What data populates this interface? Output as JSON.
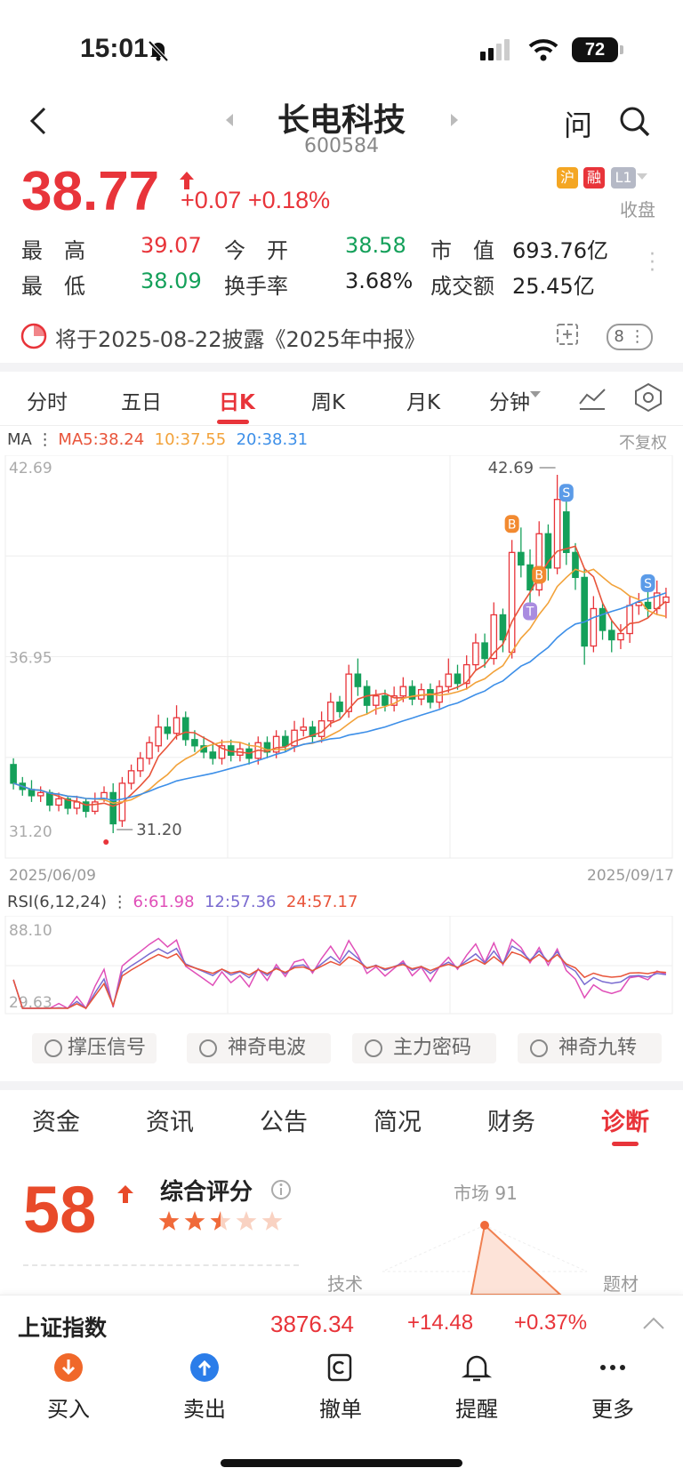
{
  "status_bar": {
    "time": "15:01",
    "battery": "72"
  },
  "header": {
    "title": "长电科技",
    "code": "600584",
    "ask": "问"
  },
  "quote": {
    "price": "38.77",
    "change": "+0.07",
    "change_pct": "+0.18%",
    "tags": [
      {
        "text": "沪",
        "color": "#f4a623"
      },
      {
        "text": "融",
        "color": "#e8343a"
      },
      {
        "text": "L1",
        "color": "#b5b9c6"
      }
    ],
    "status": "收盘",
    "rows": [
      [
        {
          "label": "最　高",
          "value": "39.07",
          "color": "red"
        },
        {
          "label": "今　开",
          "value": "38.58",
          "color": "green"
        },
        {
          "label": "市　值",
          "value": "693.76亿",
          "color": "plain"
        }
      ],
      [
        {
          "label": "最　低",
          "value": "38.09",
          "color": "green"
        },
        {
          "label": "换手率",
          "value": "3.68%",
          "color": "plain"
        },
        {
          "label": "成交额",
          "value": "25.45亿",
          "color": "plain"
        }
      ]
    ],
    "notice": "将于2025-08-22披露《2025年中报》",
    "notice_count": "8"
  },
  "chart_tabs": [
    "分时",
    "五日",
    "日K",
    "周K",
    "月K",
    "分钟"
  ],
  "chart_tab_active": 2,
  "ma": {
    "label": "MA",
    "ma5": "MA5:38.24",
    "ma10": "10:37.55",
    "ma20": "20:38.31",
    "adjust": "不复权"
  },
  "chart_data": {
    "type": "candlestick",
    "date_start": "2025/06/09",
    "date_end": "2025/09/17",
    "y_ticks": [
      "42.69",
      "36.95",
      "31.20"
    ],
    "ylim": [
      31.2,
      42.69
    ],
    "high_label": "42.69",
    "low_label": "31.20",
    "markers": [
      {
        "text": "B",
        "index": 55,
        "color": "#f28a30"
      },
      {
        "text": "B",
        "index": 58,
        "color": "#f28a30"
      },
      {
        "text": "T",
        "index": 57,
        "color": "#a98ce0"
      },
      {
        "text": "S",
        "index": 61,
        "color": "#5b9be8"
      },
      {
        "text": "S",
        "index": 70,
        "color": "#5b9be8"
      }
    ],
    "candles": [
      [
        33.4,
        32.8,
        33.6,
        32.6
      ],
      [
        32.8,
        32.6,
        33.0,
        32.4
      ],
      [
        32.6,
        32.4,
        32.9,
        32.2
      ],
      [
        32.4,
        32.5,
        32.7,
        32.2
      ],
      [
        32.5,
        32.1,
        32.6,
        31.9
      ],
      [
        32.1,
        32.3,
        32.5,
        31.9
      ],
      [
        32.3,
        32.0,
        32.4,
        31.8
      ],
      [
        32.0,
        32.2,
        32.4,
        31.8
      ],
      [
        32.2,
        31.9,
        32.3,
        31.7
      ],
      [
        31.9,
        32.2,
        32.5,
        31.8
      ],
      [
        32.3,
        32.5,
        32.7,
        32.2
      ],
      [
        32.5,
        31.5,
        32.8,
        31.2
      ],
      [
        31.6,
        32.8,
        33.0,
        31.4
      ],
      [
        32.8,
        33.2,
        33.4,
        32.6
      ],
      [
        33.2,
        33.6,
        33.8,
        33.0
      ],
      [
        33.6,
        34.1,
        34.3,
        33.4
      ],
      [
        34.0,
        34.6,
        35.0,
        33.8
      ],
      [
        34.6,
        34.4,
        34.9,
        34.2
      ],
      [
        34.4,
        34.9,
        35.3,
        34.2
      ],
      [
        34.9,
        34.2,
        35.1,
        34.0
      ],
      [
        34.2,
        34.0,
        34.5,
        33.8
      ],
      [
        34.0,
        33.8,
        34.3,
        33.6
      ],
      [
        33.8,
        33.6,
        34.1,
        33.4
      ],
      [
        33.6,
        34.0,
        34.2,
        33.4
      ],
      [
        34.0,
        33.7,
        34.2,
        33.5
      ],
      [
        33.7,
        33.9,
        34.1,
        33.5
      ],
      [
        33.9,
        33.6,
        34.1,
        33.4
      ],
      [
        33.6,
        34.1,
        34.3,
        33.4
      ],
      [
        34.1,
        33.8,
        34.3,
        33.6
      ],
      [
        33.8,
        34.3,
        34.5,
        33.6
      ],
      [
        34.3,
        34.0,
        34.5,
        33.8
      ],
      [
        34.0,
        34.5,
        34.8,
        33.8
      ],
      [
        34.5,
        34.6,
        34.9,
        34.3
      ],
      [
        34.6,
        34.3,
        34.8,
        34.1
      ],
      [
        34.3,
        34.8,
        35.1,
        34.1
      ],
      [
        34.8,
        35.4,
        35.7,
        34.6
      ],
      [
        35.4,
        35.1,
        35.6,
        34.9
      ],
      [
        35.1,
        36.3,
        36.6,
        34.9
      ],
      [
        36.3,
        35.9,
        36.8,
        35.6
      ],
      [
        35.9,
        35.3,
        36.1,
        35.0
      ],
      [
        35.3,
        35.6,
        35.8,
        35.0
      ],
      [
        35.6,
        35.3,
        35.8,
        35.1
      ],
      [
        35.3,
        35.6,
        35.9,
        35.1
      ],
      [
        35.6,
        35.9,
        36.2,
        35.4
      ],
      [
        35.9,
        35.5,
        36.1,
        35.3
      ],
      [
        35.5,
        35.8,
        36.0,
        35.3
      ],
      [
        35.8,
        35.4,
        36.0,
        35.2
      ],
      [
        35.4,
        35.9,
        36.1,
        35.2
      ],
      [
        35.9,
        36.3,
        36.8,
        35.7
      ],
      [
        36.3,
        36.0,
        36.6,
        35.8
      ],
      [
        36.0,
        36.6,
        36.9,
        35.8
      ],
      [
        36.6,
        37.3,
        37.6,
        36.4
      ],
      [
        37.3,
        36.8,
        37.6,
        36.5
      ],
      [
        36.8,
        38.2,
        38.6,
        36.6
      ],
      [
        38.2,
        37.4,
        38.4,
        37.0
      ],
      [
        37.0,
        40.2,
        40.6,
        36.8
      ],
      [
        40.2,
        39.8,
        41.0,
        39.4
      ],
      [
        39.8,
        39.0,
        40.3,
        38.6
      ],
      [
        39.0,
        40.8,
        41.2,
        38.8
      ],
      [
        40.8,
        39.7,
        41.1,
        39.3
      ],
      [
        39.7,
        41.9,
        42.69,
        39.5
      ],
      [
        41.5,
        40.2,
        42.0,
        39.8
      ],
      [
        40.2,
        39.4,
        40.5,
        39.0
      ],
      [
        39.4,
        37.2,
        39.7,
        36.6
      ],
      [
        37.2,
        38.4,
        38.8,
        37.0
      ],
      [
        38.4,
        37.7,
        38.6,
        37.4
      ],
      [
        37.7,
        37.4,
        38.0,
        37.0
      ],
      [
        37.4,
        37.6,
        37.9,
        37.1
      ],
      [
        37.6,
        38.5,
        38.8,
        37.3
      ],
      [
        38.5,
        38.6,
        38.9,
        38.2
      ],
      [
        38.6,
        38.4,
        39.1,
        38.1
      ],
      [
        38.4,
        38.9,
        39.3,
        38.2
      ],
      [
        38.6,
        38.77,
        39.07,
        38.09
      ]
    ]
  },
  "rsi": {
    "label": "RSI(6,12,24)",
    "v6": "6:61.98",
    "v12": "12:57.36",
    "v24": "24:57.17",
    "top": "88.10",
    "bottom": "29.63"
  },
  "tools": [
    "撑压信号",
    "神奇电波",
    "主力密码",
    "神奇九转"
  ],
  "feature_tabs": [
    "资金",
    "资讯",
    "公告",
    "简况",
    "财务",
    "诊断"
  ],
  "feature_tab_active": 5,
  "diagnosis": {
    "score": "58",
    "title": "综合评分",
    "stars": 2.5,
    "radar_labels": [
      "市场 91",
      "技术",
      "题材"
    ]
  },
  "index_bar": {
    "name": "上证指数",
    "value": "3876.34",
    "change": "+14.48",
    "pct": "+0.37%"
  },
  "bottom_nav": [
    {
      "label": "买入",
      "color": "#f0682a"
    },
    {
      "label": "卖出",
      "color": "#2b7de9"
    },
    {
      "label": "撤单"
    },
    {
      "label": "提醒"
    },
    {
      "label": "更多"
    }
  ]
}
